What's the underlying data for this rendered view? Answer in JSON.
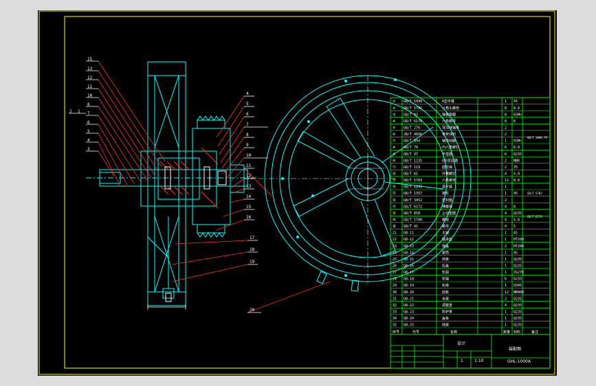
{
  "colors": {
    "background": "#000000",
    "frame": "#ffff00",
    "table_lines": "#00ff00",
    "machine": "#00ffff",
    "leaders": "#ff3030",
    "balloons": "#ffffff",
    "table_text": "#ffffff"
  },
  "balloons_left": [
    "15",
    "13",
    "12",
    "11",
    "10",
    "8",
    "7",
    "6",
    "5",
    "4",
    "3",
    "2",
    "1"
  ],
  "balloons_top_right": [
    "4",
    "5",
    "6",
    "7",
    "8",
    "9",
    "10",
    "11",
    "12",
    "13",
    "14",
    "15",
    "16"
  ],
  "balloons_bottom": [
    "17",
    "18",
    "19",
    "20"
  ],
  "bom": {
    "rows": [
      {
        "no": "①",
        "code": "GB/T 1096",
        "name": "A型平键",
        "qty": "1",
        "mat": "45"
      },
      {
        "no": "②",
        "code": "GB/T 5782",
        "name": "六角头螺栓",
        "qty": "8",
        "mat": "8.8"
      },
      {
        "no": "③",
        "code": "GB/T 93",
        "name": "弹簧垫圈",
        "qty": "8",
        "mat": "65Mn"
      },
      {
        "no": "④",
        "code": "GB/T 6170",
        "name": "六角螺母",
        "qty": "8",
        "mat": "8"
      },
      {
        "no": "⑤",
        "code": "GB/T 276",
        "name": "深沟球轴承",
        "qty": "2",
        "mat": ""
      },
      {
        "no": "⑥",
        "code": "JB/T 4606",
        "name": "骨架油封",
        "qty": "2",
        "mat": ""
      },
      {
        "no": "⑦",
        "code": "GB/T 894",
        "name": "轴用挡圈",
        "qty": "1",
        "mat": "65Mn"
      },
      {
        "no": "⑧",
        "code": "GB/T 70",
        "name": "内六角螺钉",
        "qty": "6",
        "mat": "8.8"
      },
      {
        "no": "⑨",
        "code": "GB/T 97",
        "name": "平垫圈",
        "qty": "6",
        "mat": "Q235"
      },
      {
        "no": "⑩",
        "code": "GB/T 1235",
        "name": "O形密封圈",
        "qty": "2",
        "mat": "NBR"
      },
      {
        "no": "⑪",
        "code": "GB/T 119",
        "name": "圆柱销",
        "qty": "2",
        "mat": "35"
      },
      {
        "no": "⑫",
        "code": "GB/T 65",
        "name": "开槽螺钉",
        "qty": "4",
        "mat": "4.8"
      },
      {
        "no": "⑬",
        "code": "GB/T 5783",
        "name": "六角螺栓",
        "qty": "12",
        "mat": "8.8"
      },
      {
        "no": "⑭",
        "code": "GB/T 1243",
        "name": "滚子链",
        "qty": "1",
        "mat": ""
      },
      {
        "no": "⑮",
        "code": "GB/T 1357",
        "name": "链轮",
        "qty": "1",
        "mat": "45"
      },
      {
        "no": "⑯",
        "code": "GB/T 3452",
        "name": "密封圈",
        "qty": "2",
        "mat": ""
      },
      {
        "no": "⑰",
        "code": "GB/T 6172",
        "name": "薄螺母",
        "qty": "4",
        "mat": "8"
      },
      {
        "no": "⑱",
        "code": "GB/T 858",
        "name": "止动垫圈",
        "qty": "4",
        "mat": "Q235"
      },
      {
        "no": "⑲",
        "code": "GB/T 5780",
        "name": "螺栓",
        "qty": "4",
        "mat": "4.8"
      },
      {
        "no": "⑳",
        "code": "GB/T 41",
        "name": "螺母",
        "qty": "4",
        "mat": "5"
      },
      {
        "no": "21",
        "code": "GB-11",
        "name": "主轴",
        "qty": "1",
        "mat": "45"
      },
      {
        "no": "22",
        "code": "GB-12",
        "name": "轴承座",
        "qty": "1",
        "mat": "HT200"
      },
      {
        "no": "23",
        "code": "GB-13",
        "name": "端盖",
        "qty": "2",
        "mat": "HT200"
      },
      {
        "no": "24",
        "code": "GB-14",
        "name": "套筒",
        "qty": "1",
        "mat": "45"
      },
      {
        "no": "25",
        "code": "GB-15",
        "name": "挡板",
        "qty": "1",
        "mat": "Q235"
      },
      {
        "no": "26",
        "code": "GB-16",
        "name": "压盖",
        "qty": "1",
        "mat": "Q235"
      },
      {
        "no": "27",
        "code": "GB-17",
        "name": "轮毂",
        "qty": "1",
        "mat": "ZG270"
      },
      {
        "no": "28",
        "code": "GB-18",
        "name": "轮辐",
        "qty": "6",
        "mat": "Q235"
      },
      {
        "no": "29",
        "code": "GB-19",
        "name": "轮缘",
        "qty": "1",
        "mat": "Q345"
      },
      {
        "no": "30",
        "code": "GB-20",
        "name": "刮板",
        "qty": "12",
        "mat": "NM400"
      },
      {
        "no": "31",
        "code": "GB-21",
        "name": "支座",
        "qty": "2",
        "mat": "Q235"
      },
      {
        "no": "32",
        "code": "GB-22",
        "name": "调整垫",
        "qty": "4",
        "mat": "Q235"
      },
      {
        "no": "33",
        "code": "GB-23",
        "name": "防护罩",
        "qty": "1",
        "mat": "Q235"
      },
      {
        "no": "34",
        "code": "GB-24",
        "name": "盖板",
        "qty": "1",
        "mat": "Q235"
      },
      {
        "no": "35",
        "code": "GB-25",
        "name": "底座",
        "qty": "1",
        "mat": "Q235"
      }
    ],
    "header": {
      "no": "序号",
      "code": "代号",
      "name": "名称",
      "qty": "数量",
      "mat": "材料",
      "note": "备注"
    }
  },
  "title_block": {
    "assembly_name": "装配图",
    "drawing_no": "GHL-1000A",
    "company": "设计",
    "scale": "1:10",
    "sheet": "1"
  },
  "notes_right": [
    "GB/T 1096-79",
    "GB/T 5782",
    "GB/T 6170"
  ]
}
